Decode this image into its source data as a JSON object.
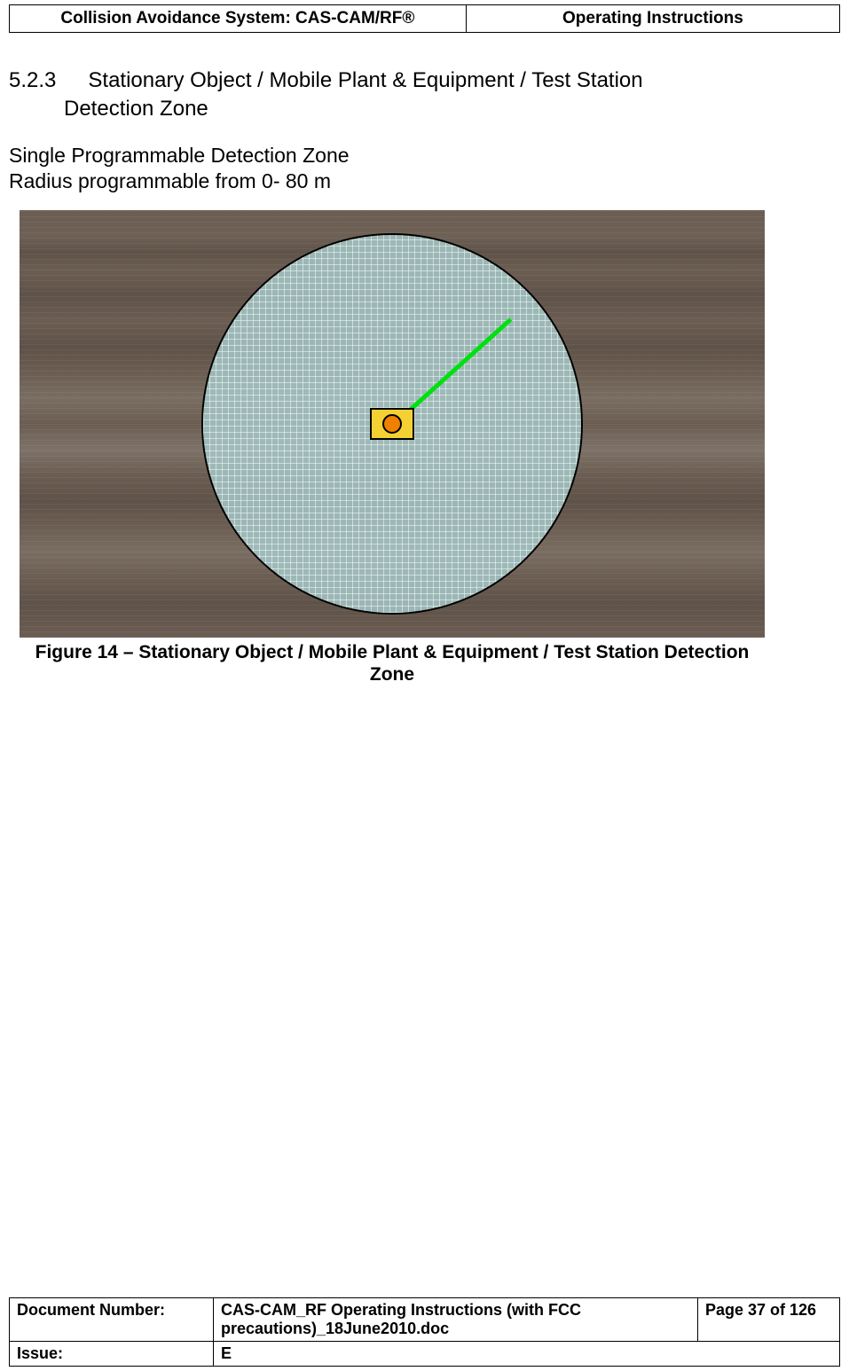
{
  "header": {
    "left": "Collision Avoidance System: CAS-CAM/RF®",
    "right": "Operating Instructions"
  },
  "section": {
    "number": "5.2.3",
    "title_line1": "Stationary Object / Mobile Plant & Equipment / Test Station",
    "title_line2": "Detection Zone"
  },
  "body": {
    "line1": "Single Programmable Detection Zone",
    "line2": "Radius programmable from 0- 80 m"
  },
  "figure": {
    "caption_line1": "Figure 14 – Stationary Object / Mobile Plant & Equipment / Test Station Detection",
    "caption_line2": "Zone"
  },
  "footer": {
    "docnum_label": "Document Number:",
    "docnum_value": "CAS-CAM_RF Operating Instructions (with FCC precautions)_18June2010.doc",
    "page": "Page 37 of  126",
    "issue_label": "Issue:",
    "issue_value": "E"
  }
}
